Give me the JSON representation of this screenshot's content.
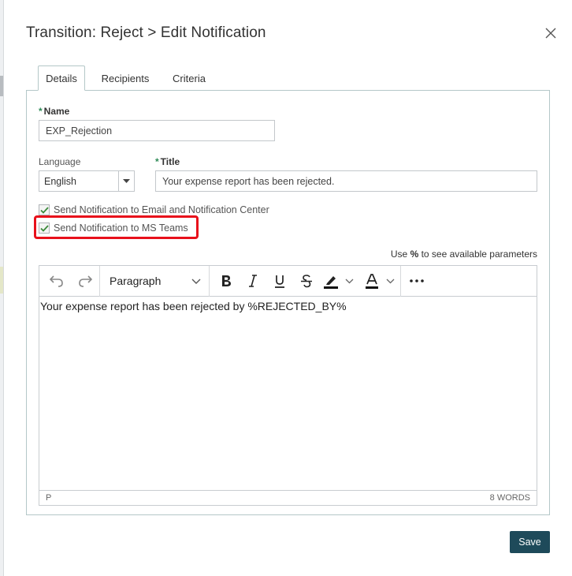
{
  "dialog": {
    "title": "Transition: Reject > Edit Notification",
    "save_label": "Save"
  },
  "tabs": [
    {
      "label": "Details",
      "active": true
    },
    {
      "label": "Recipients",
      "active": false
    },
    {
      "label": "Criteria",
      "active": false
    }
  ],
  "form": {
    "name_label": "Name",
    "name_value": "EXP_Rejection",
    "language_label": "Language",
    "language_value": "English",
    "title_label": "Title",
    "title_value": "Your expense report has been rejected.",
    "required_mark": "*",
    "email_checkbox_label": "Send Notification to Email and Notification Center",
    "email_checked": true,
    "teams_checkbox_label": "Send Notification to MS Teams",
    "teams_checked": true,
    "param_hint_prefix": "Use ",
    "param_hint_symbol": "%",
    "param_hint_suffix": " to see available parameters"
  },
  "editor": {
    "paragraph_label": "Paragraph",
    "body_text": "Your expense report has been rejected by %REJECTED_BY%",
    "status_element": "P",
    "word_count": "8 WORDS"
  },
  "icons": [
    "close-icon",
    "undo-icon",
    "redo-icon",
    "chevron-down-icon",
    "bold-icon",
    "italic-icon",
    "underline-icon",
    "strikethrough-icon",
    "highlight-color-icon",
    "text-color-icon",
    "more-icon",
    "check-icon"
  ],
  "colors": {
    "highlight_box": "#e8101b",
    "save_button": "#1e4a5a",
    "required": "#2e8b57",
    "panel_border": "#b4c7c8"
  }
}
